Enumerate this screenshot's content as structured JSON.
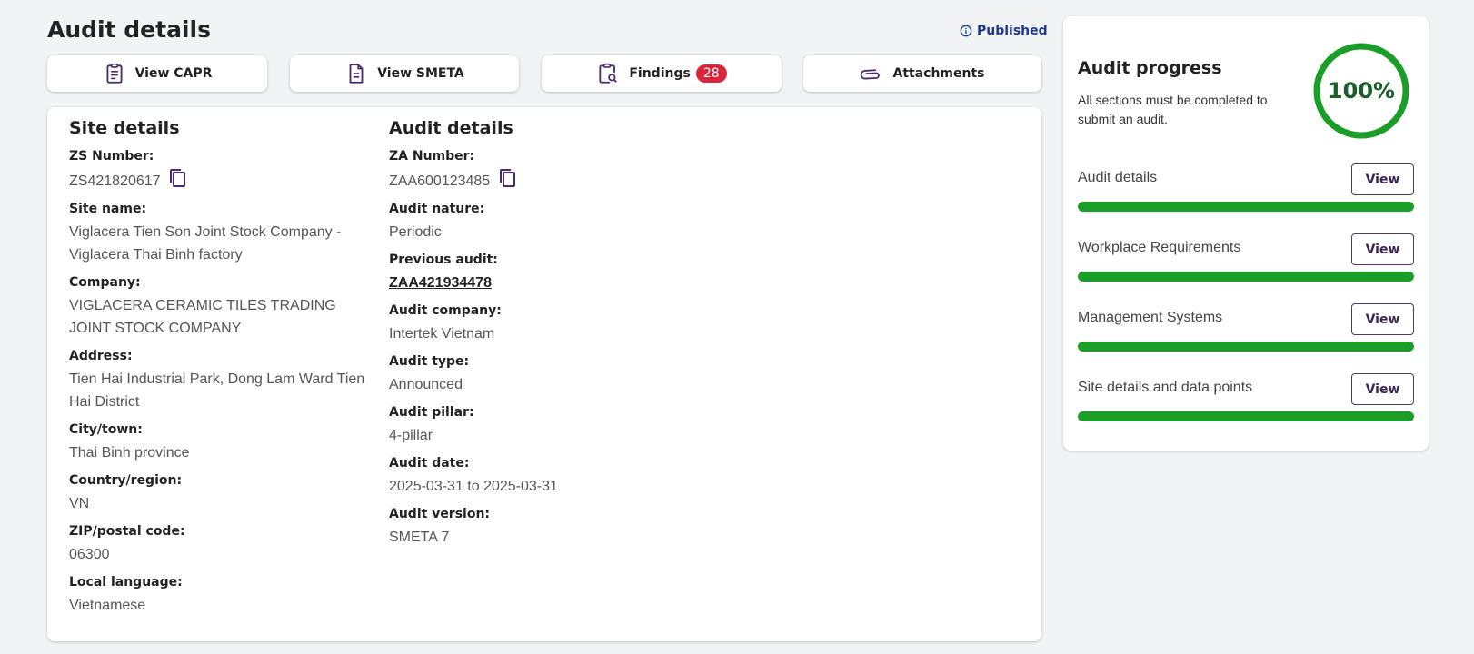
{
  "header": {
    "title": "Audit details",
    "status": "Published"
  },
  "actions": [
    {
      "label": "View CAPR",
      "icon": "clipboard-list-icon"
    },
    {
      "label": "View SMETA",
      "icon": "document-icon"
    },
    {
      "label": "Findings",
      "icon": "clipboard-search-icon",
      "badge": "28"
    },
    {
      "label": "Attachments",
      "icon": "paperclip-icon"
    }
  ],
  "site": {
    "title": "Site details",
    "fields": [
      {
        "label": "ZS Number:",
        "value": "ZS421820617",
        "copy": true
      },
      {
        "label": "Site name:",
        "value": "Viglacera Tien Son Joint Stock Company - Viglacera Thai Binh factory"
      },
      {
        "label": "Company:",
        "value": "VIGLACERA CERAMIC TILES TRADING JOINT STOCK COMPANY"
      },
      {
        "label": "Address:",
        "value": "Tien Hai Industrial Park, Dong Lam Ward Tien Hai District"
      },
      {
        "label": "City/town:",
        "value": "Thai Binh province"
      },
      {
        "label": "Country/region:",
        "value": "VN"
      },
      {
        "label": "ZIP/postal code:",
        "value": "06300"
      },
      {
        "label": "Local language:",
        "value": "Vietnamese"
      }
    ]
  },
  "audit": {
    "title": "Audit details",
    "fields": [
      {
        "label": "ZA Number:",
        "value": "ZAA600123485",
        "copy": true
      },
      {
        "label": "Audit nature:",
        "value": "Periodic"
      },
      {
        "label": "Previous audit:",
        "value": "ZAA421934478",
        "link": true
      },
      {
        "label": "Audit company:",
        "value": "Intertek Vietnam"
      },
      {
        "label": "Audit type:",
        "value": "Announced"
      },
      {
        "label": "Audit pillar:",
        "value": "4-pillar"
      },
      {
        "label": "Audit date:",
        "value": "2025-03-31 to 2025-03-31"
      },
      {
        "label": "Audit version:",
        "value": "SMETA 7"
      }
    ]
  },
  "progress": {
    "title": "Audit progress",
    "description": "All sections must be completed to submit an audit.",
    "percent_label": "100%",
    "percent": 100,
    "sections": [
      {
        "label": "Audit details",
        "button": "View",
        "progress": 1.0
      },
      {
        "label": "Workplace Requirements",
        "button": "View",
        "progress": 1.0
      },
      {
        "label": "Management Systems",
        "button": "View",
        "progress": 1.0
      },
      {
        "label": "Site details and data points",
        "button": "View",
        "progress": 1.0
      }
    ]
  },
  "colors": {
    "accent_purple": "#4a2a6a",
    "progress_green": "#1a9e28",
    "badge_red": "#d9263c",
    "status_blue": "#1e3a8a"
  }
}
